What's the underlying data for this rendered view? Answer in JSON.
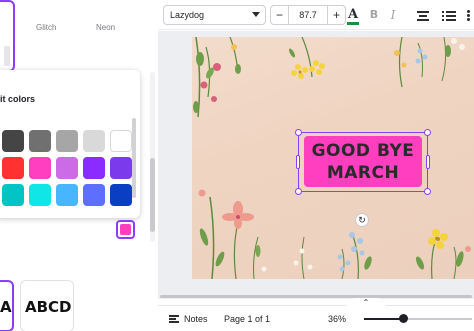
{
  "effects": {
    "labels": [
      "Glitch",
      "Neon"
    ]
  },
  "color_popup": {
    "title": "it colors",
    "swatches": [
      "#454545",
      "#707070",
      "#a6a6a6",
      "#d9d9d9",
      "#ffffff",
      "#ff3131",
      "#ff3fbf",
      "#cb6ce6",
      "#8c2bff",
      "#7c3aed",
      "#03c4c4",
      "#11e6e6",
      "#47b6ff",
      "#5e6eff",
      "#0a3fc4"
    ],
    "selected_color": "#ff3fbf"
  },
  "font_samples": [
    "ABCD",
    "ABCD"
  ],
  "toolbar": {
    "font_name": "Lazydog",
    "font_size": "87.7",
    "minus_label": "−",
    "plus_label": "+",
    "text_color_label": "A",
    "bold_label": "B",
    "italic_label": "I",
    "text_color": "#1b8f3b"
  },
  "canvas": {
    "headline_line1": "GOOD BYE",
    "headline_line2": "MARCH",
    "text_box_color": "#ff3fbf",
    "background_color": "#efd4c2",
    "decoration": "watercolor wildflowers"
  },
  "bottom_bar": {
    "notes_label": "Notes",
    "page_label": "Page 1 of 1",
    "zoom_label": "36%",
    "zoom_fraction": 0.36
  },
  "colors": {
    "accent": "#8b3dff"
  }
}
